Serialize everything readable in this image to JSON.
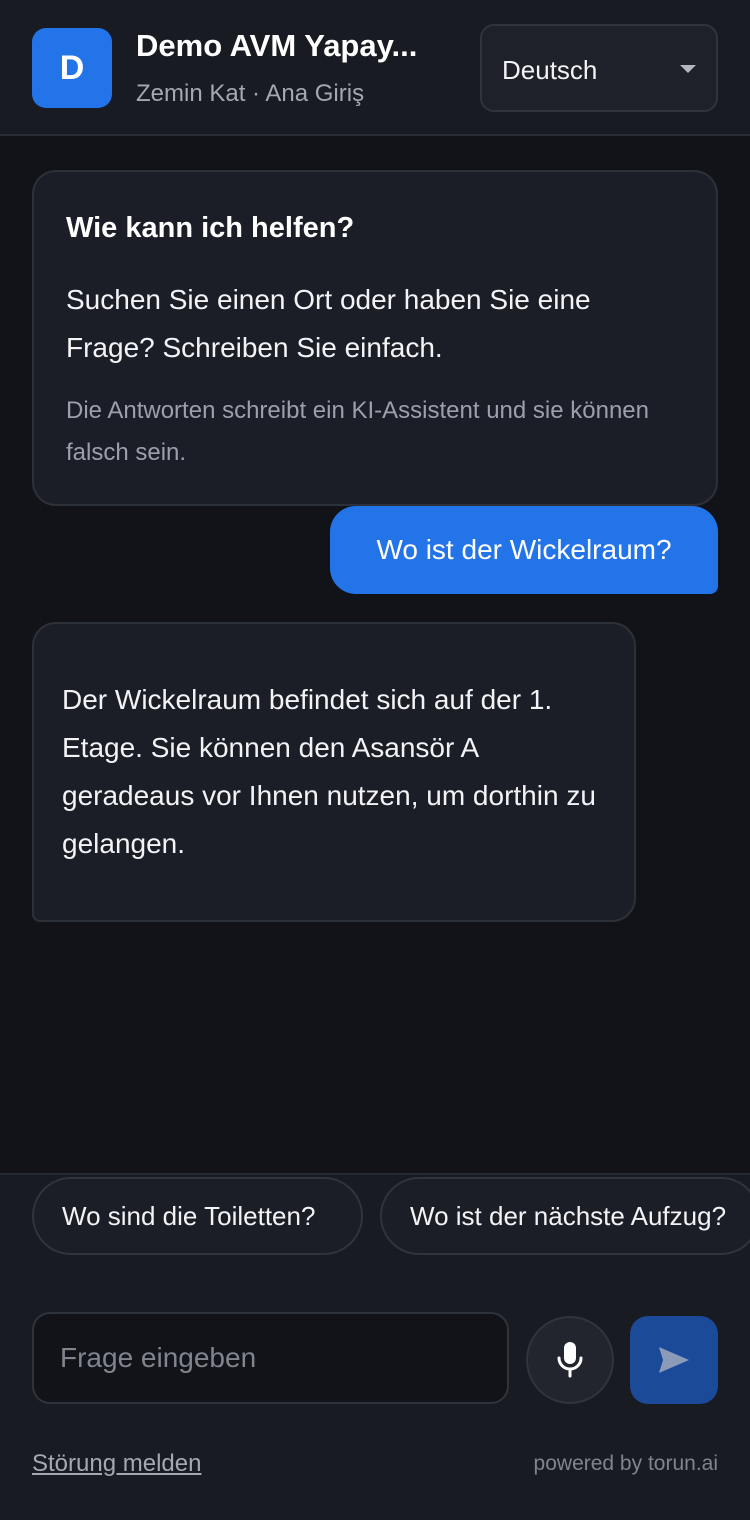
{
  "header": {
    "avatar_letter": "D",
    "title": "Demo AVM Yapay...",
    "subtitle": "Zemin Kat · Ana Giriş",
    "language": "Deutsch"
  },
  "intro": {
    "heading": "Wie kann ich helfen?",
    "text": "Suchen Sie einen Ort oder haben Sie eine Frage? Schreiben Sie einfach.",
    "disclaimer": "Die Antworten schreibt ein KI-Assistent und sie können falsch sein."
  },
  "messages": [
    {
      "role": "user",
      "text": "Wo ist der Wickelraum?"
    },
    {
      "role": "assistant",
      "text": "Der Wickelraum befindet sich auf der 1. Etage. Sie können den Asansör A geradeaus vor Ihnen nutzen, um dorthin zu gelangen."
    }
  ],
  "suggestions": [
    "Wo sind die Toiletten?",
    "Wo ist der nächste Aufzug?"
  ],
  "input": {
    "placeholder": "Frage eingeben",
    "value": ""
  },
  "icons": {
    "mic": "microphone-icon",
    "send": "send-icon",
    "caret": "chevron-down-icon"
  },
  "footer": {
    "report_label": "Störung melden",
    "powered_by": "powered by torun.ai"
  },
  "colors": {
    "accent": "#2374e8",
    "background": "#111318",
    "surface": "#1b1e26"
  }
}
